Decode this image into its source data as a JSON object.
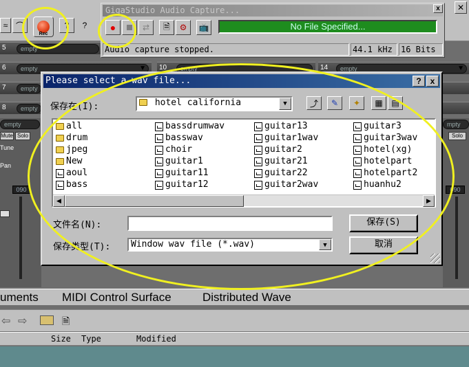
{
  "background_app": {
    "record_button": {
      "label": "Rec"
    },
    "help_icon_label": "?",
    "context_help_label": "?",
    "mixer_rows": [
      {
        "num": "5",
        "slot": "empty"
      },
      {
        "num": "6",
        "slot": "empty"
      },
      {
        "num": "7",
        "slot": "empty"
      },
      {
        "num": "8",
        "slot": "empty"
      }
    ],
    "mixer_mid": [
      {
        "num": "10",
        "slot": "empty"
      },
      {
        "num": "14",
        "slot": "empty"
      }
    ],
    "strip_labels": {
      "empty": "empty",
      "mute": "Mute",
      "solo": "Solo",
      "tune": "Tune",
      "pan": "Pan",
      "level": "090"
    },
    "right_strip": {
      "empty": "mpty",
      "solo": "Solo",
      "level": "090"
    },
    "tabs": [
      "uments",
      "MIDI Control Surface",
      "Distributed Wave"
    ],
    "file_columns": [
      "Size",
      "Type",
      "Modified"
    ]
  },
  "capture_window": {
    "title": "GigaStudio Audio Capture...",
    "close_label": "x",
    "file_status": "No File Specified...",
    "status_text": "Audio capture stopped.",
    "sample_rate": "44.1 kHz",
    "bit_depth": "16 Bits"
  },
  "dialog": {
    "title": "Please select a wav file...",
    "help_label": "?",
    "close_label": "x",
    "save_in_label": "保存在(I):",
    "save_in_value": "hotel california",
    "files": [
      {
        "name": "all",
        "type": "folder"
      },
      {
        "name": "drum",
        "type": "folder"
      },
      {
        "name": "jpeg",
        "type": "folder"
      },
      {
        "name": "New",
        "type": "folder"
      },
      {
        "name": "aoul",
        "type": "wav"
      },
      {
        "name": "bass",
        "type": "wav"
      },
      {
        "name": "bassdrumwav",
        "type": "wav"
      },
      {
        "name": "basswav",
        "type": "wav"
      },
      {
        "name": "choir",
        "type": "wav"
      },
      {
        "name": "guitar1",
        "type": "wav"
      },
      {
        "name": "guitar11",
        "type": "wav"
      },
      {
        "name": "guitar12",
        "type": "wav"
      },
      {
        "name": "guitar13",
        "type": "wav"
      },
      {
        "name": "guitar1wav",
        "type": "wav"
      },
      {
        "name": "guitar2",
        "type": "wav"
      },
      {
        "name": "guitar21",
        "type": "wav"
      },
      {
        "name": "guitar22",
        "type": "wav"
      },
      {
        "name": "guitar2wav",
        "type": "wav"
      },
      {
        "name": "guitar3",
        "type": "wav"
      },
      {
        "name": "guitar3wav",
        "type": "wav"
      },
      {
        "name": "hotel(xg)",
        "type": "wav"
      },
      {
        "name": "hotelpart",
        "type": "wav"
      },
      {
        "name": "hotelpart2",
        "type": "wav"
      },
      {
        "name": "huanhu2",
        "type": "wav"
      }
    ],
    "filename_label": "文件名(N):",
    "filename_value": "",
    "filetype_label": "保存类型(T):",
    "filetype_value": "Window wav file (*.wav)",
    "save_button": "保存(S)",
    "cancel_button": "取消"
  },
  "colors": {
    "annotation": "#f0f020",
    "title_bar": "#0a246a",
    "status_green": "#1e8c1e"
  }
}
